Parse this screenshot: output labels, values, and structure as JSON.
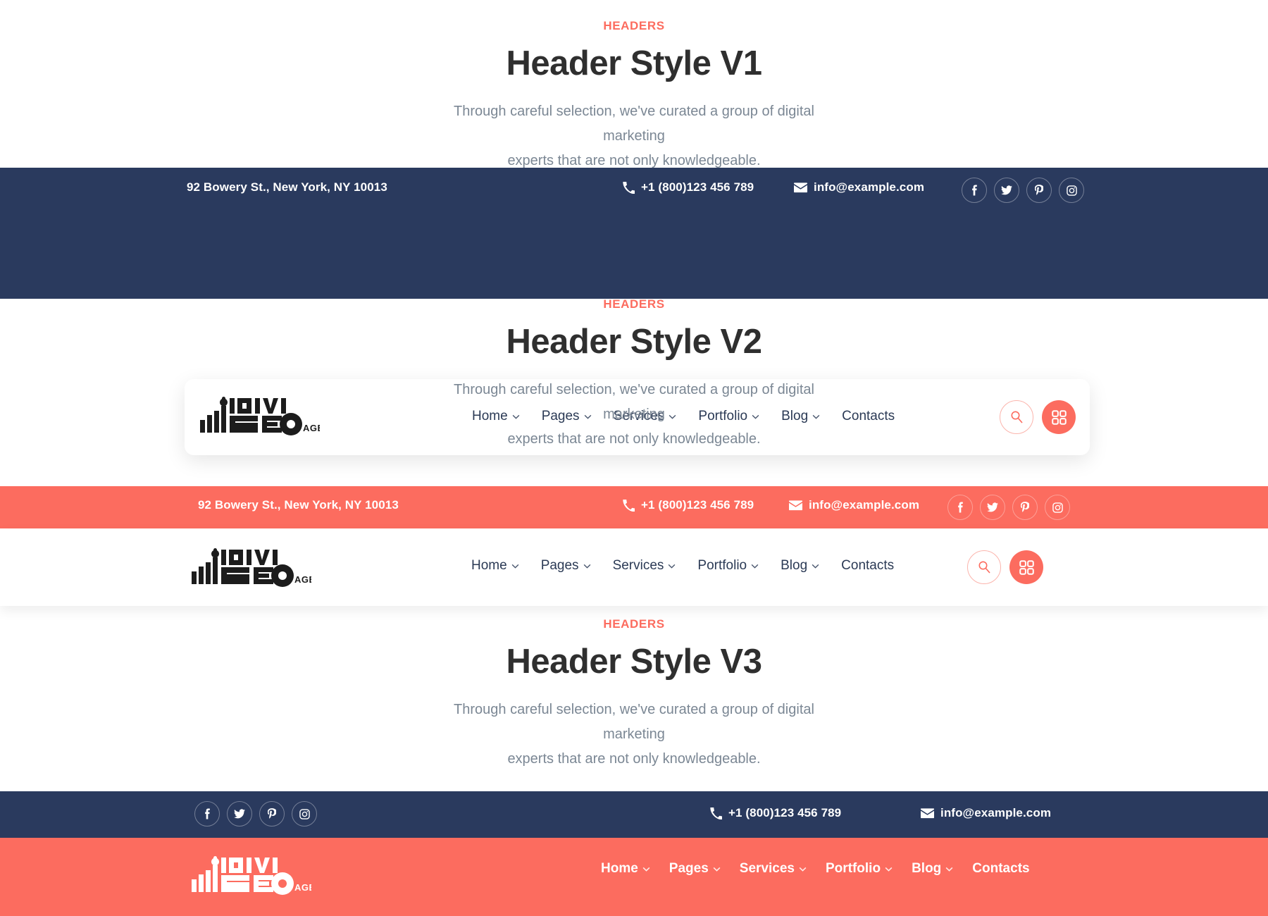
{
  "brand": {
    "accent": "#fc6c5f",
    "navy": "#2a3a5e",
    "logo_text": "DIVI SEO AGENCY",
    "logo_line1": "DIVI",
    "logo_line2": "SEO",
    "logo_suffix": "AGENCY"
  },
  "sections": [
    {
      "eyebrow": "HEADERS",
      "title": "Header Style V1",
      "body_line1": "Through careful selection, we've curated a group of digital marketing",
      "body_line2": "experts that are not only knowledgeable."
    },
    {
      "eyebrow": "HEADERS",
      "title": "Header Style V2",
      "body_line1": "Through careful selection, we've curated a group of digital marketing",
      "body_line2": "experts that are not only knowledgeable."
    },
    {
      "eyebrow": "HEADERS",
      "title": "Header Style V3",
      "body_line1": "Through careful selection, we've curated a group of digital marketing",
      "body_line2": "experts that are not only knowledgeable."
    }
  ],
  "contact": {
    "address": "92 Bowery St., New York, NY 10013",
    "phone": "+1 (800)123 456 789",
    "email": "info@example.com",
    "phone_icon": "phone-icon",
    "email_icon": "envelope-icon"
  },
  "social": [
    {
      "name": "facebook-icon",
      "label": "Facebook"
    },
    {
      "name": "twitter-icon",
      "label": "Twitter"
    },
    {
      "name": "pinterest-icon",
      "label": "Pinterest"
    },
    {
      "name": "instagram-icon",
      "label": "Instagram"
    }
  ],
  "menu": [
    {
      "label": "Home",
      "has_dropdown": true
    },
    {
      "label": "Pages",
      "has_dropdown": true
    },
    {
      "label": "Services",
      "has_dropdown": true
    },
    {
      "label": "Portfolio",
      "has_dropdown": true
    },
    {
      "label": "Blog",
      "has_dropdown": true
    },
    {
      "label": "Contacts",
      "has_dropdown": false
    }
  ],
  "actions": {
    "search_icon": "search-icon",
    "grid_icon": "grid-menu-icon"
  }
}
